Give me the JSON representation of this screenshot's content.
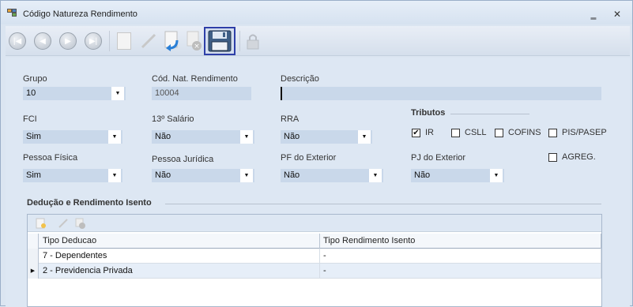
{
  "window": {
    "title": "Código Natureza Rendimento",
    "minimize_glyph": "‗",
    "close_glyph": "✕"
  },
  "toolbar": {
    "buttons": [
      "first-icon",
      "previous-icon",
      "next-icon",
      "last-icon",
      "new-icon",
      "edit-icon",
      "undo-icon",
      "delete-icon",
      "save-icon",
      "lock-icon"
    ],
    "selected": "save-icon"
  },
  "form": {
    "grupo": {
      "label": "Grupo",
      "value": "10"
    },
    "cod_nat": {
      "label": "Cód. Nat. Rendimento",
      "value": "10004"
    },
    "descricao": {
      "label": "Descrição",
      "value": ""
    },
    "fci": {
      "label": "FCI",
      "value": "Sim"
    },
    "decimo_terceiro": {
      "label": "13º Salário",
      "value": "Não"
    },
    "rra": {
      "label": "RRA",
      "value": "Não"
    },
    "pessoa_fisica": {
      "label": "Pessoa Física",
      "value": "Sim"
    },
    "pessoa_juridica": {
      "label": "Pessoa Jurídica",
      "value": "Não"
    },
    "pf_exterior": {
      "label": "PF do Exterior",
      "value": "Não"
    },
    "pj_exterior": {
      "label": "PJ do Exterior",
      "value": "Não"
    }
  },
  "tributos": {
    "title": "Tributos",
    "ir": {
      "label": "IR",
      "checked": true,
      "mark": "✔"
    },
    "csll": {
      "label": "CSLL",
      "checked": false
    },
    "cofins": {
      "label": "COFINS",
      "checked": false
    },
    "pis_pasep": {
      "label": "PIS/PASEP",
      "checked": false
    },
    "agreg": {
      "label": "AGREG.",
      "checked": false
    }
  },
  "deducao": {
    "title": "Dedução e Rendimento Isento",
    "columns": [
      "Tipo Deducao",
      "Tipo Rendimento Isento"
    ],
    "rows": [
      {
        "tipo_deducao": "7 - Dependentes",
        "tipo_rendimento": "-",
        "current": false
      },
      {
        "tipo_deducao": "2 - Previdencia Privada",
        "tipo_rendimento": "-",
        "current": true
      }
    ]
  },
  "colors": {
    "field_bg": "#c9d8ea",
    "selection_border": "#2e3fa8"
  }
}
